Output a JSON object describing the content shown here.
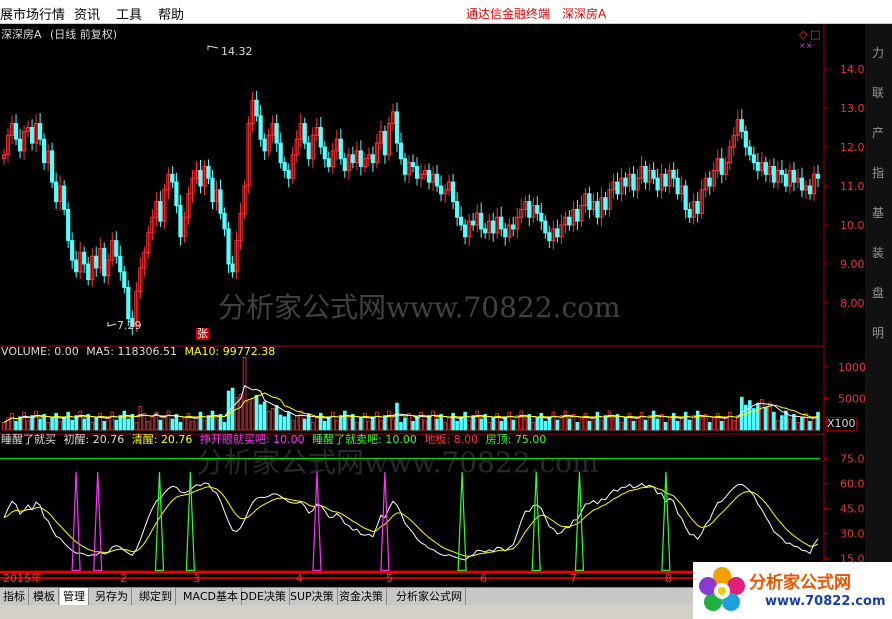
{
  "menu": {
    "items": [
      "展市场行情",
      "资讯",
      "工具",
      "帮助"
    ],
    "terminal_name": "通达信金融终端",
    "stock_name": "深深房A"
  },
  "chart_header": {
    "stock_title": "深深房A",
    "period_info": "(日线 前复权)",
    "high_marker": "14.32",
    "low_marker": "7.29",
    "zhang_marker": "张"
  },
  "volume_header": {
    "volume_label": "VOLUME:",
    "volume_value": "0.00",
    "ma5_label": "MA5:",
    "ma5_value": "118306.51",
    "ma10_label": "MA10:",
    "ma10_value": "99772.38",
    "unit_label": "X100"
  },
  "indicator_header": {
    "name": "睡醒了就买",
    "chu_xing_label": "初醒:",
    "chu_xing_value": "20.76",
    "qing_xing_label": "清醒:",
    "qing_xing_value": "20.76",
    "zheng_kai_label": "挣开眼就买吧:",
    "zheng_kai_value": "10.00",
    "shui_xing_label": "睡醒了就卖吧:",
    "shui_xing_value": "10.00",
    "di_ban_label": "地板:",
    "di_ban_value": "8.00",
    "fang_ding_label": "房顶:",
    "fang_ding_value": "75.00"
  },
  "right_strip_chars": [
    "力",
    "联",
    "产",
    "指",
    "基",
    "装",
    "盘",
    "明"
  ],
  "watermark": "分析家公式网www.70822.com",
  "timeline": {
    "year_label": "2015年",
    "months": [
      "2",
      "3",
      "4",
      "5",
      "6",
      "7",
      "8"
    ]
  },
  "tabs": [
    "指标",
    "模板",
    "管理",
    "另存为",
    "绑定到",
    "MACD基本",
    "DDE决策",
    "SUP决策",
    "资金决策",
    "分析家公式网"
  ],
  "active_tab": "管理",
  "logo": {
    "name": "分析家公式网",
    "url": "www.70822.com"
  },
  "colors": {
    "up": "#ff3232",
    "down": "#54ffff",
    "ma5": "#ffffff",
    "ma10": "#ffff00",
    "buy_spike": "#ff32ff",
    "sell_spike": "#32ff32",
    "floor": "#ff0000",
    "ceiling": "#00ff00",
    "grid": "#800000"
  },
  "chart_data": [
    {
      "type": "candlestick",
      "title": "深深房A(日线 前复权)",
      "ylim": [
        7.0,
        15.0
      ],
      "yticks": [
        8.0,
        9.0,
        10.0,
        11.0,
        12.0,
        13.0,
        14.0
      ],
      "annotations": [
        {
          "label": "14.32",
          "value": 14.32
        },
        {
          "label": "7.29",
          "value": 7.29
        }
      ],
      "close_series": [
        11.8,
        12.3,
        12.6,
        12.2,
        11.9,
        12.4,
        12.5,
        12.1,
        12.6,
        12.2,
        11.6,
        11.9,
        11.1,
        10.6,
        11.0,
        10.4,
        9.6,
        9.1,
        8.8,
        9.3,
        9.0,
        8.6,
        9.2,
        8.9,
        9.4,
        8.7,
        9.1,
        9.6,
        9.2,
        8.8,
        8.4,
        7.6,
        7.4,
        8.3,
        8.9,
        9.3,
        9.8,
        10.2,
        10.6,
        10.1,
        10.9,
        11.3,
        11.1,
        10.5,
        9.7,
        10.2,
        10.8,
        11.2,
        11.4,
        11.0,
        11.5,
        11.2,
        10.6,
        10.9,
        10.3,
        9.9,
        9.0,
        8.8,
        9.6,
        10.3,
        11.0,
        12.6,
        13.2,
        12.8,
        12.2,
        11.9,
        12.3,
        12.6,
        12.1,
        11.6,
        11.4,
        11.2,
        11.8,
        12.2,
        12.6,
        12.1,
        11.7,
        12.3,
        12.5,
        12.0,
        11.7,
        11.5,
        11.9,
        12.2,
        11.7,
        11.4,
        11.8,
        11.6,
        11.9,
        11.5,
        11.7,
        11.8,
        11.6,
        12.1,
        12.4,
        11.8,
        12.6,
        12.9,
        12.1,
        11.7,
        11.3,
        11.6,
        11.5,
        11.2,
        11.3,
        11.4,
        11.1,
        11.3,
        11.0,
        10.8,
        10.9,
        11.1,
        10.6,
        10.2,
        10.0,
        9.7,
        10.1,
        10.0,
        10.3,
        9.9,
        9.8,
        10.1,
        9.8,
        10.2,
        9.9,
        9.7,
        10.0,
        9.9,
        10.2,
        10.4,
        10.6,
        10.2,
        10.5,
        10.3,
        10.1,
        9.8,
        9.6,
        9.9,
        9.7,
        10.0,
        10.2,
        10.0,
        10.4,
        10.1,
        10.5,
        10.8,
        10.4,
        10.6,
        10.2,
        10.7,
        10.4,
        10.9,
        11.1,
        10.8,
        11.2,
        11.0,
        11.3,
        10.9,
        11.2,
        11.5,
        11.1,
        11.4,
        11.2,
        10.9,
        11.3,
        11.0,
        11.4,
        11.2,
        10.8,
        11.0,
        10.4,
        10.2,
        10.6,
        10.3,
        10.9,
        11.2,
        11.0,
        11.4,
        11.7,
        11.3,
        11.6,
        12.0,
        12.3,
        12.7,
        12.4,
        12.0,
        11.8,
        11.6,
        11.4,
        11.6,
        11.3,
        11.5,
        11.1,
        11.4,
        11.3,
        11.0,
        11.4,
        11.1,
        11.2,
        10.9,
        11.0,
        10.8,
        11.3,
        11.2
      ]
    },
    {
      "type": "bar",
      "title": "VOLUME",
      "ylim": [
        0,
        13000
      ],
      "yticks": [
        5000,
        10000
      ],
      "series": [
        {
          "name": "MA5",
          "value": 118306.51
        },
        {
          "name": "MA10",
          "value": 99772.38
        }
      ]
    },
    {
      "type": "line",
      "title": "睡醒了就买",
      "ylim": [
        10,
        85
      ],
      "yticks": [
        15.0,
        30.0,
        45.0,
        60.0,
        75.0
      ],
      "series": [
        {
          "name": "初醒",
          "last": 20.76
        },
        {
          "name": "清醒",
          "last": 20.76
        },
        {
          "name": "地板",
          "value": 8.0
        },
        {
          "name": "房顶",
          "value": 75.0
        }
      ],
      "buy_spike_positions": [
        0.12,
        0.155,
        0.51,
        0.62
      ],
      "sell_spike_positions": [
        0.255,
        0.305,
        0.745,
        0.865,
        0.935,
        1.075
      ]
    }
  ]
}
